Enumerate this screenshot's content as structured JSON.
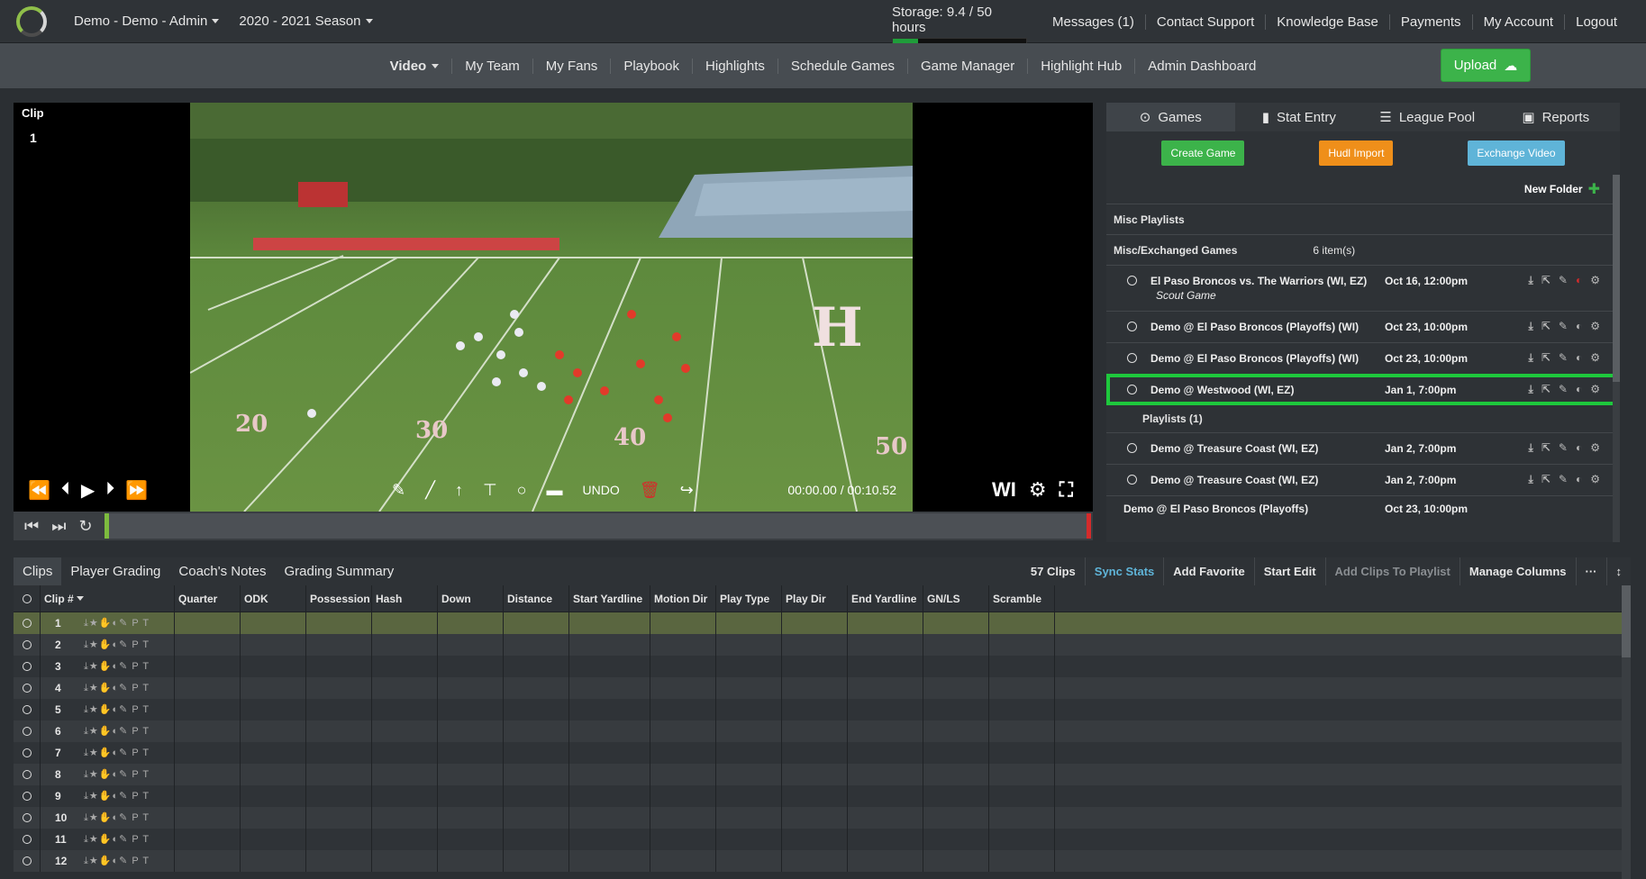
{
  "topbar": {
    "team": "Demo - Demo - Admin",
    "season": "2020 - 2021 Season",
    "storage_label": "Storage: 9.4 / 50 hours",
    "storage_fraction": 0.188,
    "links": [
      "Messages (1)",
      "Contact Support",
      "Knowledge Base",
      "Payments",
      "My Account",
      "Logout"
    ]
  },
  "nav": {
    "items": [
      "Video",
      "My Team",
      "My Fans",
      "Playbook",
      "Highlights",
      "Schedule Games",
      "Game Manager",
      "Highlight Hub",
      "Admin Dashboard"
    ],
    "upload": "Upload"
  },
  "video": {
    "clip_label": "Clip",
    "clip_number": "1",
    "undo": "UNDO",
    "time": "00:00.00 / 00:10.52",
    "wi": "WI"
  },
  "rpanel": {
    "tabs": [
      "Games",
      "Stat Entry",
      "League Pool",
      "Reports"
    ],
    "buttons": [
      "Create Game",
      "Hudl Import",
      "Exchange Video"
    ],
    "new_folder": "New Folder",
    "misc_playlists": "Misc Playlists",
    "misc_exchanged": "Misc/Exchanged Games",
    "items_count": "6 item(s)",
    "games": [
      {
        "name": "El Paso Broncos vs. The Warriors (WI, EZ)",
        "sub": "Scout Game",
        "date": "Oct 16, 12:00pm"
      },
      {
        "name": "Demo @ El Paso Broncos (Playoffs) (WI)",
        "sub": "",
        "date": "Oct 23, 10:00pm"
      },
      {
        "name": "Demo @ El Paso Broncos (Playoffs) (WI)",
        "sub": "",
        "date": "Oct 23, 10:00pm"
      },
      {
        "name": "Demo @ Westwood (WI, EZ)",
        "sub": "",
        "date": "Jan 1, 7:00pm"
      }
    ],
    "playlists": "Playlists (1)",
    "games2": [
      {
        "name": "Demo @ Treasure Coast (WI, EZ)",
        "date": "Jan 2, 7:00pm"
      },
      {
        "name": "Demo @ Treasure Coast (WI, EZ)",
        "date": "Jan 2, 7:00pm"
      },
      {
        "name": "Demo @ El Paso Broncos (Playoffs)",
        "date": "Oct 23, 10:00pm"
      }
    ]
  },
  "bottom": {
    "tabs": [
      "Clips",
      "Player Grading",
      "Coach's Notes",
      "Grading Summary"
    ],
    "count": "57 Clips",
    "tools": [
      "Sync Stats",
      "Add Favorite",
      "Start Edit",
      "Add Clips To Playlist",
      "Manage Columns",
      "···",
      "↕"
    ],
    "columns": [
      "Clip #",
      "Quarter",
      "ODK",
      "Possession",
      "Hash",
      "Down",
      "Distance",
      "Start Yardline",
      "Motion Dir",
      "Play Type",
      "Play Dir",
      "End Yardline",
      "GN/LS",
      "Scramble"
    ],
    "row_icons": "⤓★✋◐✎ P T",
    "rows": [
      "1",
      "2",
      "3",
      "4",
      "5",
      "6",
      "7",
      "8",
      "9",
      "10",
      "11",
      "12"
    ]
  }
}
